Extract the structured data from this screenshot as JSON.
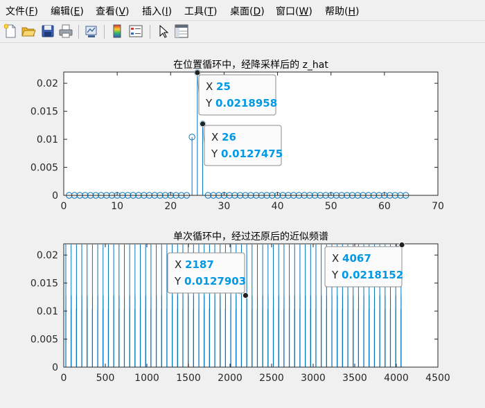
{
  "menu": {
    "items": [
      {
        "label": "文件(F)",
        "u": "F"
      },
      {
        "label": "编辑(E)",
        "u": "E"
      },
      {
        "label": "查看(V)",
        "u": "V"
      },
      {
        "label": "插入(I)",
        "u": "I"
      },
      {
        "label": "工具(T)",
        "u": "T"
      },
      {
        "label": "桌面(D)",
        "u": "D"
      },
      {
        "label": "窗口(W)",
        "u": "W"
      },
      {
        "label": "帮助(H)",
        "u": "H"
      }
    ]
  },
  "toolbar": {
    "icons": [
      "new-figure-icon",
      "open-folder-icon",
      "save-icon",
      "print-icon",
      "link-figure-icon",
      "colorbar-icon",
      "legend-icon",
      "pointer-arrow-icon",
      "property-inspector-icon"
    ]
  },
  "colors": {
    "series": "#0072bd",
    "datatip_value": "#0099e6",
    "axes": "#262626"
  },
  "chart_data": [
    {
      "type": "stem",
      "title": "在位置循环中，经降采样后的 z_hat",
      "xlim": [
        0,
        70
      ],
      "ylim": [
        0,
        0.022
      ],
      "xticks": [
        0,
        10,
        20,
        30,
        40,
        50,
        60,
        70
      ],
      "yticks": [
        0,
        0.005,
        0.01,
        0.015,
        0.02
      ],
      "ytick_labels": [
        "0",
        "0.005",
        "0.01",
        "0.015",
        "0.02"
      ],
      "marker": "circle",
      "series": [
        {
          "x": [
            1,
            2,
            3,
            4,
            5,
            6,
            7,
            8,
            9,
            10,
            11,
            12,
            13,
            14,
            15,
            16,
            17,
            18,
            19,
            20,
            21,
            22,
            23,
            24,
            25,
            26,
            27,
            28,
            29,
            30,
            31,
            32,
            33,
            34,
            35,
            36,
            37,
            38,
            39,
            40,
            41,
            42,
            43,
            44,
            45,
            46,
            47,
            48,
            49,
            50,
            51,
            52,
            53,
            54,
            55,
            56,
            57,
            58,
            59,
            60,
            61,
            62,
            63,
            64
          ],
          "y": [
            0,
            0,
            0,
            0,
            0,
            0,
            0,
            0,
            0,
            0,
            0,
            0,
            0,
            0,
            0,
            0,
            0,
            0,
            0,
            0,
            0,
            0,
            0,
            0.0104,
            0.0218958,
            0.0127475,
            0,
            0,
            0,
            0,
            0,
            0,
            0,
            0,
            0,
            0,
            0,
            0,
            0,
            0,
            0,
            0,
            0,
            0,
            0,
            0,
            0,
            0,
            0,
            0,
            0,
            0,
            0,
            0,
            0,
            0,
            0,
            0,
            0,
            0,
            0,
            0,
            0,
            0
          ]
        }
      ],
      "datatips": [
        {
          "x": 25,
          "y": 0.0218958,
          "x_text": "25",
          "y_text": "0.0218958"
        },
        {
          "x": 26,
          "y": 0.0127475,
          "x_text": "26",
          "y_text": "0.0127475"
        }
      ]
    },
    {
      "type": "stem",
      "title": "单次循环中，经过还原后的近似频谱",
      "xlim": [
        0,
        4500
      ],
      "ylim": [
        0,
        0.022
      ],
      "xticks": [
        0,
        500,
        1000,
        1500,
        2000,
        2500,
        3000,
        3500,
        4000,
        4500
      ],
      "yticks": [
        0,
        0.005,
        0.01,
        0.015,
        0.02
      ],
      "ytick_labels": [
        "0",
        "0.005",
        "0.01",
        "0.015",
        "0.02"
      ],
      "marker": "none",
      "series": [
        {
          "spacing": 64,
          "count": 64,
          "y_pattern": [
            0.0104,
            0.0218958,
            0.0127475
          ],
          "offsets": [
            -1,
            0,
            1
          ],
          "first_peak": 25
        }
      ],
      "datatips": [
        {
          "x": 2187,
          "y": 0.0127903,
          "x_text": "2187",
          "y_text": "0.0127903"
        },
        {
          "x": 4067,
          "y": 0.0218152,
          "x_text": "4067",
          "y_text": "0.0218152"
        }
      ]
    }
  ]
}
